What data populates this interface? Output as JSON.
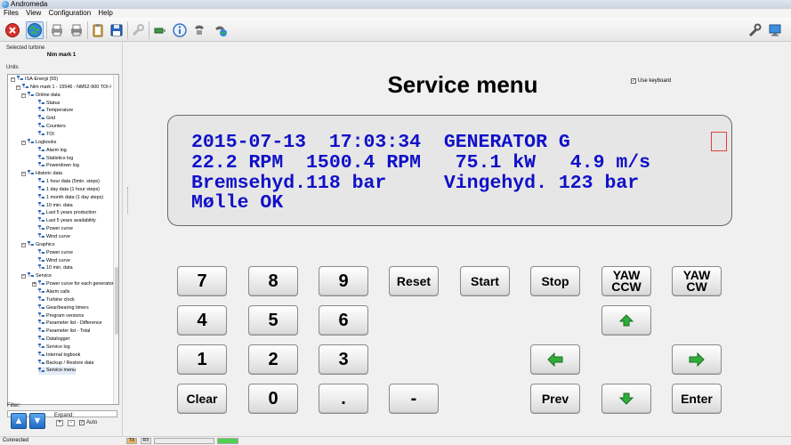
{
  "window": {
    "title": "Andromeda"
  },
  "menu": [
    "Files",
    "View",
    "Configuration",
    "Help"
  ],
  "left": {
    "selected_label": "Selected turbine",
    "selected_turbine": "Nim mark 1",
    "units_label": "Units",
    "filter_label": "Filter:",
    "expand_label": "Expand:",
    "expand_plus": "+",
    "expand_minus": "-",
    "auto_label": "Auto",
    "auto_checked": "✓",
    "tree": [
      {
        "label": "ISA-Energi (55)",
        "level": 0,
        "expander": "−"
      },
      {
        "label": "Nim mark 1 - 15546 - NM52-900 TOI-I",
        "level": 1,
        "expander": "−"
      },
      {
        "label": "Online data",
        "level": 2,
        "expander": "−"
      },
      {
        "label": "Status",
        "level": 3
      },
      {
        "label": "Temperature",
        "level": 3
      },
      {
        "label": "Grid",
        "level": 3
      },
      {
        "label": "Counters",
        "level": 3
      },
      {
        "label": "TOI",
        "level": 3
      },
      {
        "label": "Logbooks",
        "level": 2,
        "expander": "−"
      },
      {
        "label": "Alarm log",
        "level": 3
      },
      {
        "label": "Statistics log",
        "level": 3
      },
      {
        "label": "Powerdown log",
        "level": 3
      },
      {
        "label": "Historic data",
        "level": 2,
        "expander": "−"
      },
      {
        "label": "1 hour data (5min. steps)",
        "level": 3
      },
      {
        "label": "1 day data (1 hour steps)",
        "level": 3
      },
      {
        "label": "1 month data (1 day steps)",
        "level": 3
      },
      {
        "label": "10 min. data",
        "level": 3
      },
      {
        "label": "Last 5 years production",
        "level": 3
      },
      {
        "label": "Last 5 years availability",
        "level": 3
      },
      {
        "label": "Power curve",
        "level": 3
      },
      {
        "label": "Wind curve",
        "level": 3
      },
      {
        "label": "Graphics",
        "level": 2,
        "expander": "−"
      },
      {
        "label": "Power curve",
        "level": 3
      },
      {
        "label": "Wind curve",
        "level": 3
      },
      {
        "label": "10 min. data",
        "level": 3
      },
      {
        "label": "Service",
        "level": 2,
        "expander": "−"
      },
      {
        "label": "Power curve for each generator",
        "level": 3,
        "expander": "+"
      },
      {
        "label": "Alarm calls",
        "level": 3
      },
      {
        "label": "Turbine clock",
        "level": 3
      },
      {
        "label": "Gear/bearing timers",
        "level": 3
      },
      {
        "label": "Program versions",
        "level": 3
      },
      {
        "label": "Parameter list - Difference",
        "level": 3
      },
      {
        "label": "Parameter list - Total",
        "level": 3
      },
      {
        "label": "Datalogger",
        "level": 3
      },
      {
        "label": "Service log",
        "level": 3
      },
      {
        "label": "Internal logbook",
        "level": 3
      },
      {
        "label": "Backup / Restore data",
        "level": 3
      },
      {
        "label": "Service menu",
        "level": 3,
        "selected": true
      }
    ]
  },
  "main": {
    "title": "Service menu",
    "use_keyboard_label": "Use keyboard",
    "use_keyboard_checked": "✓",
    "display_lines": [
      "2015-07-13  17:03:34  GENERATOR G",
      "22.2 RPM  1500.4 RPM   75.1 kW   4.9 m/s",
      "Bremsehyd.118 bar     Vingehyd. 123 bar",
      "Mølle OK"
    ],
    "keys": {
      "k7": "7",
      "k8": "8",
      "k9": "9",
      "k4": "4",
      "k5": "5",
      "k6": "6",
      "k1": "1",
      "k2": "2",
      "k3": "3",
      "k0": "0",
      "dot": ".",
      "minus": "-",
      "reset": "Reset",
      "start": "Start",
      "stop": "Stop",
      "yaw_ccw": "YAW\nCCW",
      "yaw_cw": "YAW\nCW",
      "clear": "Clear",
      "prev": "Prev",
      "enter": "Enter"
    }
  },
  "status": {
    "text": "Connected",
    "tx": "TX",
    "rx": "RX"
  },
  "colors": {
    "lcd_text": "#1010c8",
    "arrow_green": "#2fae3a",
    "selection": "#e3ecf7"
  }
}
